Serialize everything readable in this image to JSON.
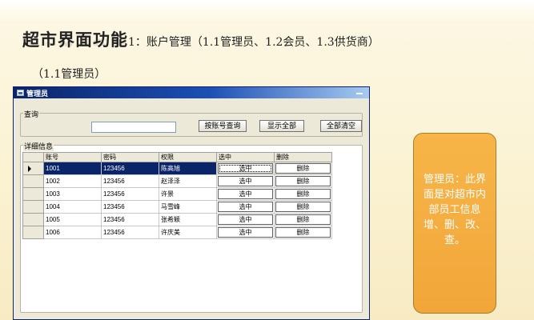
{
  "slide": {
    "title_main": "超市界面功能",
    "title_sub": "1：账户管理（1.1管理员、1.2会员、1.3供货商）",
    "subheading": "（1.1管理员）"
  },
  "window": {
    "title": "管理员",
    "query_group": {
      "label": "查询",
      "input_value": "",
      "search_button": "按账号查询",
      "show_all_button": "显示全部",
      "clear_button": "全部清空"
    },
    "detail_group": {
      "label": "详细信息",
      "columns": [
        "账号",
        "密码",
        "权限",
        "选中",
        "删除"
      ],
      "rows": [
        {
          "account": "1001",
          "password": "123456",
          "permission": "陈高旭",
          "select": "选中",
          "delete": "删除"
        },
        {
          "account": "1002",
          "password": "123456",
          "permission": "赵泽泽",
          "select": "选中",
          "delete": "删除"
        },
        {
          "account": "1003",
          "password": "123456",
          "permission": "许景",
          "select": "选中",
          "delete": "删除"
        },
        {
          "account": "1004",
          "password": "123456",
          "permission": "马雪峰",
          "select": "选中",
          "delete": "删除"
        },
        {
          "account": "1005",
          "password": "123456",
          "permission": "张希颖",
          "select": "选中",
          "delete": "删除"
        },
        {
          "account": "1006",
          "password": "123456",
          "permission": "许庆美",
          "select": "选中",
          "delete": "删除"
        }
      ],
      "selected_row": 0
    }
  },
  "callout": {
    "text": "管理员：此界面是对超市内部员工信息增、删、改、查。"
  },
  "colors": {
    "titlebar": "#0a246a",
    "callout_fill": "#f2a63a",
    "background": "#fbf2d2"
  }
}
